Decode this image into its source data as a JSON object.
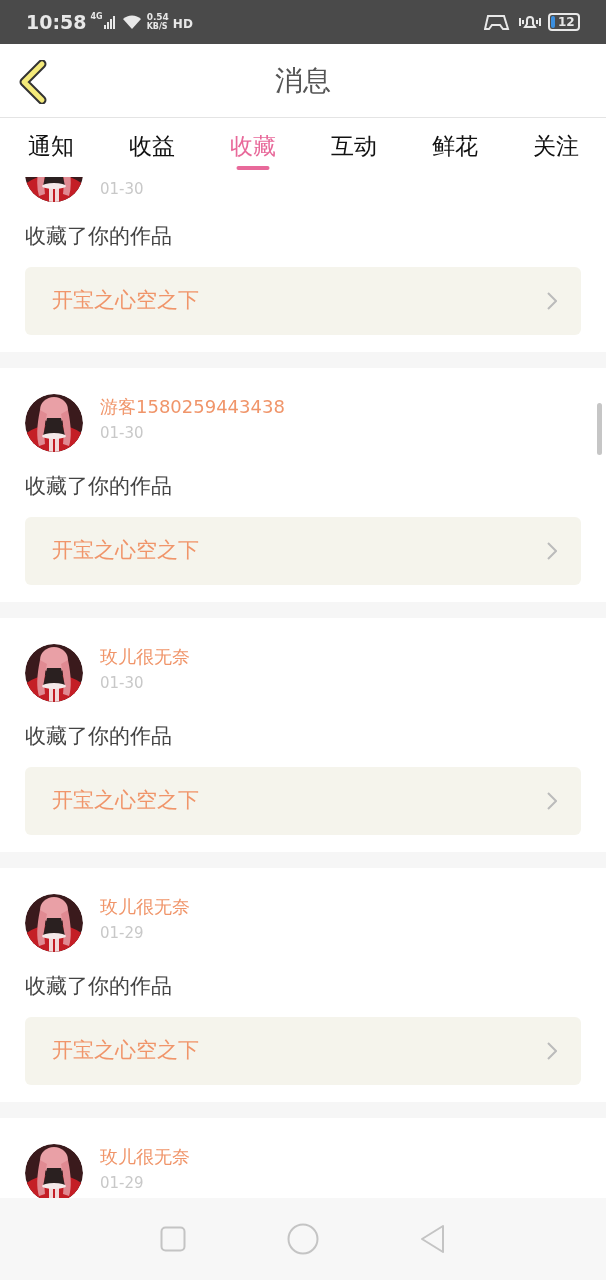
{
  "status_bar": {
    "time": "10:58",
    "network": "4G",
    "speed": "0.54",
    "speed_unit": "KB/S",
    "hd": "HD",
    "battery": "12"
  },
  "header": {
    "title": "消息"
  },
  "tabs": [
    {
      "label": "通知",
      "selected": false
    },
    {
      "label": "收益",
      "selected": false
    },
    {
      "label": "收藏",
      "selected": true
    },
    {
      "label": "互动",
      "selected": false
    },
    {
      "label": "鲜花",
      "selected": false
    },
    {
      "label": "关注",
      "selected": false
    }
  ],
  "messages": [
    {
      "date": "01-30",
      "action": "收藏了你的作品",
      "work": "开宝之心空之下"
    },
    {
      "user": "游客1580259443438",
      "date": "01-30",
      "action": "收藏了你的作品",
      "work": "开宝之心空之下"
    },
    {
      "user": "玫儿很无奈",
      "date": "01-30",
      "action": "收藏了你的作品",
      "work": "开宝之心空之下"
    },
    {
      "user": "玫儿很无奈",
      "date": "01-29",
      "action": "收藏了你的作品",
      "work": "开宝之心空之下"
    },
    {
      "user": "玫儿很无奈",
      "date": "01-29"
    }
  ]
}
